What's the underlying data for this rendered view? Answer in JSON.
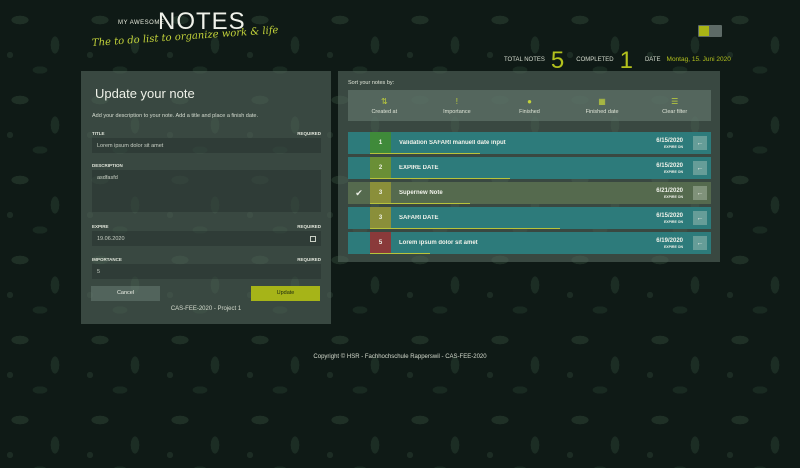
{
  "header": {
    "logo_small": "MY AWESOME",
    "logo_big": "NOTES",
    "tagline": "The to do list to organize work & life",
    "theme_toggle_color": "#a8b415"
  },
  "stats": {
    "total_label": "TOTAL NOTES",
    "total_value": "5",
    "completed_label": "COMPLETED",
    "completed_value": "1",
    "date_label": "DATE",
    "date_value": "Montag, 15. Juni 2020"
  },
  "form": {
    "title": "Update your note",
    "description": "Add your description to your note. Add a title and place a finish date.",
    "fields": {
      "title": {
        "label": "TITLE",
        "required": "REQUIRED",
        "value": "Lorem ipsum dolor sit amet"
      },
      "description": {
        "label": "DESCRIPTION",
        "value": "asdfasfd"
      },
      "expire": {
        "label": "EXPIRE",
        "required": "REQUIRED",
        "value": "19.06.2020"
      },
      "importance": {
        "label": "IMPORTANCE",
        "required": "REQUIRED",
        "value": "5"
      }
    },
    "cancel_label": "Cancel",
    "update_label": "Update",
    "footer": "CAS-FEE-2020 - Project 1"
  },
  "list": {
    "sort_label": "Sort your notes by:",
    "sort_options": [
      {
        "label": "Created at",
        "icon": "sort-icon"
      },
      {
        "label": "Importance",
        "icon": "exclamation-icon"
      },
      {
        "label": "Finished",
        "icon": "check-circle-icon"
      },
      {
        "label": "Finished date",
        "icon": "calendar-icon"
      },
      {
        "label": "Clear filter",
        "icon": "list-icon"
      }
    ],
    "notes": [
      {
        "importance": "1",
        "title": "Validation SAFARI manuell date input",
        "date": "6/15/2020",
        "status": "EXPIRE ON",
        "finished": false,
        "progress": 0.55,
        "row_color": "#2d7b7b",
        "imp_color": "#3f8a3a"
      },
      {
        "importance": "2",
        "title": "EXPIRE DATE",
        "date": "6/15/2020",
        "status": "EXPIRE ON",
        "finished": false,
        "progress": 0.7,
        "row_color": "#2d7b7b",
        "imp_color": "#6a8f36"
      },
      {
        "importance": "3",
        "title": "Supernew Note",
        "date": "6/21/2020",
        "status": "EXPIRE ON",
        "finished": true,
        "progress": 0.5,
        "row_color": "#556a4e",
        "imp_color": "#8a8f3a"
      },
      {
        "importance": "3",
        "title": "SAFARI DATE",
        "date": "6/15/2020",
        "status": "EXPIRE ON",
        "finished": false,
        "progress": 0.95,
        "row_color": "#2d7b7b",
        "imp_color": "#8a8f3a"
      },
      {
        "importance": "5",
        "title": "Lorem ipsum dolor sit amet",
        "date": "6/19/2020",
        "status": "EXPIRE ON",
        "finished": false,
        "progress": 0.3,
        "row_color": "#2d7b7b",
        "imp_color": "#8a3a3a"
      }
    ]
  },
  "footer": {
    "copyright": "Copyright © HSR - Fachhochschule Rapperswil - CAS-FEE-2020"
  }
}
